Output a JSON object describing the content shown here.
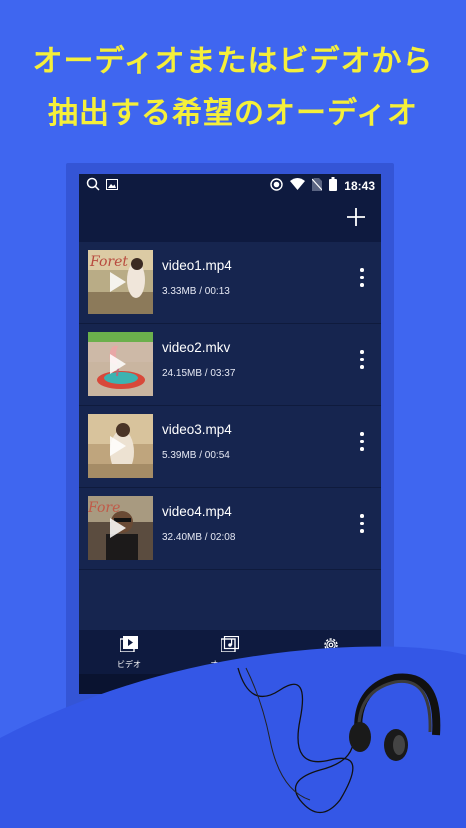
{
  "promo": {
    "line1": "オーディオまたはビデオから",
    "line2": "抽出する希望のオーディオ"
  },
  "status_bar": {
    "time": "18:43",
    "icons": [
      "search-icon",
      "image-icon",
      "record-icon",
      "wifi-icon",
      "no-sim-icon",
      "battery-icon"
    ]
  },
  "toolbar": {
    "add_icon": "plus-icon"
  },
  "videos": [
    {
      "title": "video1.mp4",
      "meta": "3.33MB / 00:13"
    },
    {
      "title": "video2.mkv",
      "meta": "24.15MB / 03:37"
    },
    {
      "title": "video3.mp4",
      "meta": "5.39MB / 00:54"
    },
    {
      "title": "video4.mp4",
      "meta": "32.40MB / 02:08"
    }
  ],
  "bottom_nav": {
    "video_label": "ビデオ",
    "audio_label": "オーディオ",
    "settings_icon": "gear-icon"
  },
  "colors": {
    "background": "#3f66f0",
    "promo_text": "#f5ef3a",
    "screen": "#16254f",
    "bar": "#0e1a3f"
  }
}
